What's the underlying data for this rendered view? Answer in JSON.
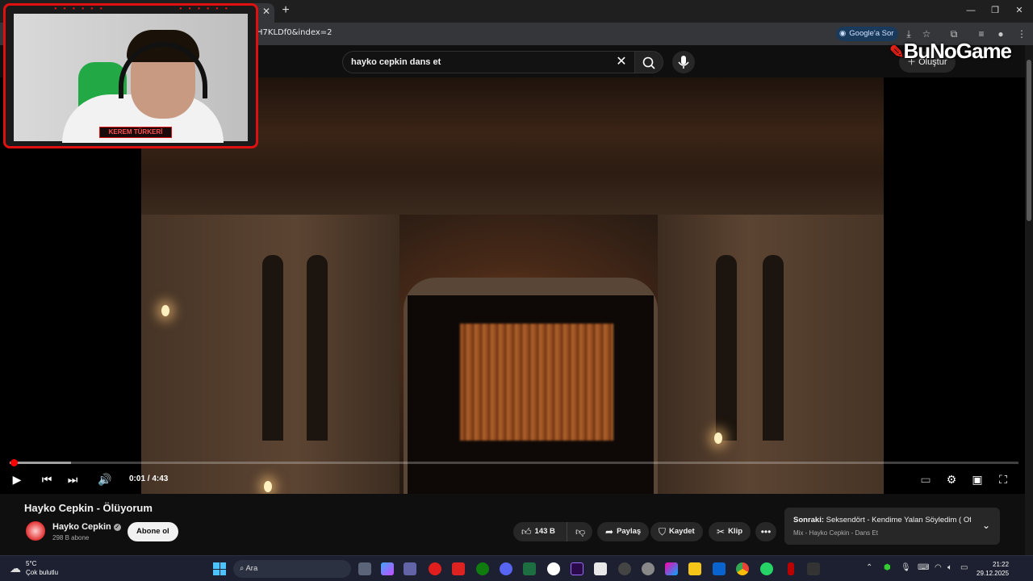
{
  "browser": {
    "url": "H7KLDf0&index=2",
    "google_sor": "Google'a Sor",
    "window_controls": [
      "minimize-icon",
      "restore-icon",
      "close-icon"
    ]
  },
  "search": {
    "query": "hayko cepkin dans et"
  },
  "header": {
    "create_label": "Oluştur",
    "watermark": "BuNoGame"
  },
  "webcam": {
    "name": "KEREM TÜRKERİ"
  },
  "player": {
    "time": "0:01 / 4:43",
    "progress_fraction": 0.004,
    "buffered_fraction": 0.061
  },
  "video": {
    "title": "Hayko Cepkin - Ölüyorum",
    "channel": "Hayko Cepkin",
    "subscribers": "298 B abone",
    "subscribe_label": "Abone ol",
    "likes": "143 B",
    "share_label": "Paylaş",
    "save_label": "Kaydet",
    "clip_label": "Klip"
  },
  "next": {
    "prefix": "Sonraki:",
    "title": "Seksendört - Kendime Yalan Söyledim ( Of...",
    "subtitle": "Mix - Hayko Cepkin - Dans Et"
  },
  "taskbar": {
    "temperature": "5°C",
    "weather": "Çok bulutlu",
    "search_placeholder": "Ara",
    "time": "21:22",
    "date": "29.12.2025"
  },
  "colors": {
    "accent_red": "#ff0000",
    "yt_bg": "#0f0f0f",
    "webcam_border": "#e01010"
  }
}
